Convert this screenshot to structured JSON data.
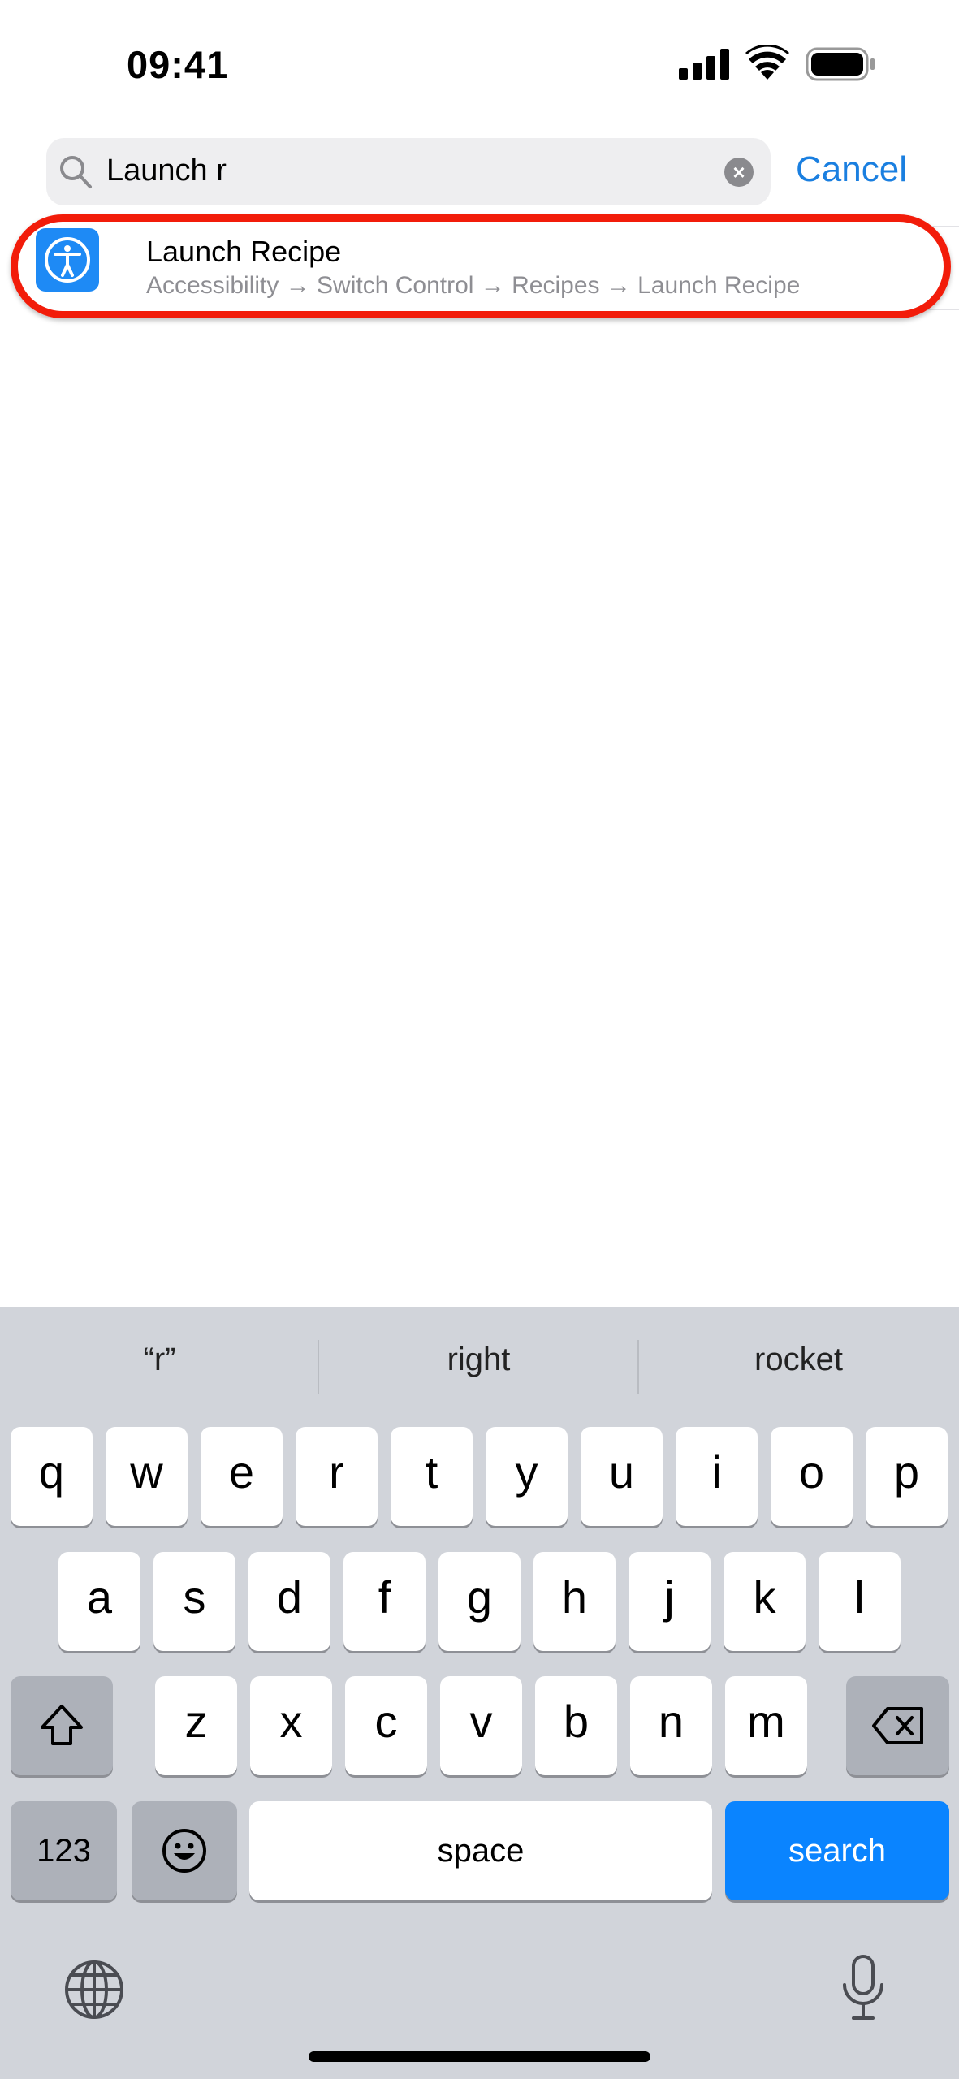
{
  "status_bar": {
    "time": "09:41",
    "icons": [
      "cellular-signal-icon",
      "wifi-icon",
      "battery-icon"
    ]
  },
  "search": {
    "value": "Launch r",
    "cancel_label": "Cancel",
    "icon": "search-icon"
  },
  "results": [
    {
      "title": "Launch Recipe",
      "path": "Accessibility → Switch Control → Recipes → Launch Recipe",
      "icon": "accessibility-icon",
      "icon_color": "#1e8af5"
    }
  ],
  "highlight_color": "#f21c0a",
  "keyboard": {
    "suggestions": [
      "“r”",
      "right",
      "rocket"
    ],
    "row1": [
      "q",
      "w",
      "e",
      "r",
      "t",
      "y",
      "u",
      "i",
      "o",
      "p"
    ],
    "row2": [
      "a",
      "s",
      "d",
      "f",
      "g",
      "h",
      "j",
      "k",
      "l"
    ],
    "row3": [
      "z",
      "x",
      "c",
      "v",
      "b",
      "n",
      "m"
    ],
    "numbers_label": "123",
    "space_label": "space",
    "search_label": "search",
    "accent_color": "#0a84ff"
  }
}
